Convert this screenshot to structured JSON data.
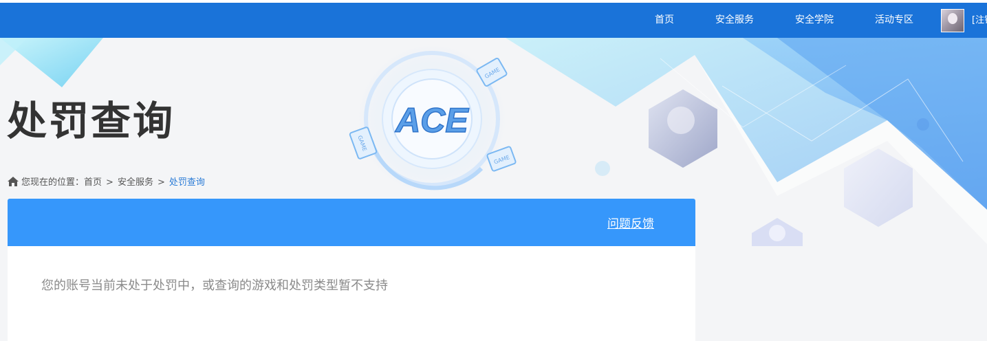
{
  "nav": {
    "items": [
      {
        "label": "首页"
      },
      {
        "label": "安全服务"
      },
      {
        "label": "安全学院"
      },
      {
        "label": "活动专区"
      }
    ],
    "user_link": "[注销]"
  },
  "banner": {
    "logo_text": "ACE",
    "game_badge": "GAME"
  },
  "page": {
    "title": "处罚查询"
  },
  "breadcrumb": {
    "prefix": "您现在的位置：",
    "items": [
      "首页",
      "安全服务"
    ],
    "separator": ">",
    "current": "处罚查询"
  },
  "card": {
    "feedback_label": "问题反馈",
    "status_message": "您的账号当前未处于处罚中，或查询的游戏和处罚类型暂不支持"
  },
  "colors": {
    "nav_bg": "#1a73d9",
    "card_header_bg": "#3697fb",
    "breadcrumb_current": "#2a7bd6"
  }
}
